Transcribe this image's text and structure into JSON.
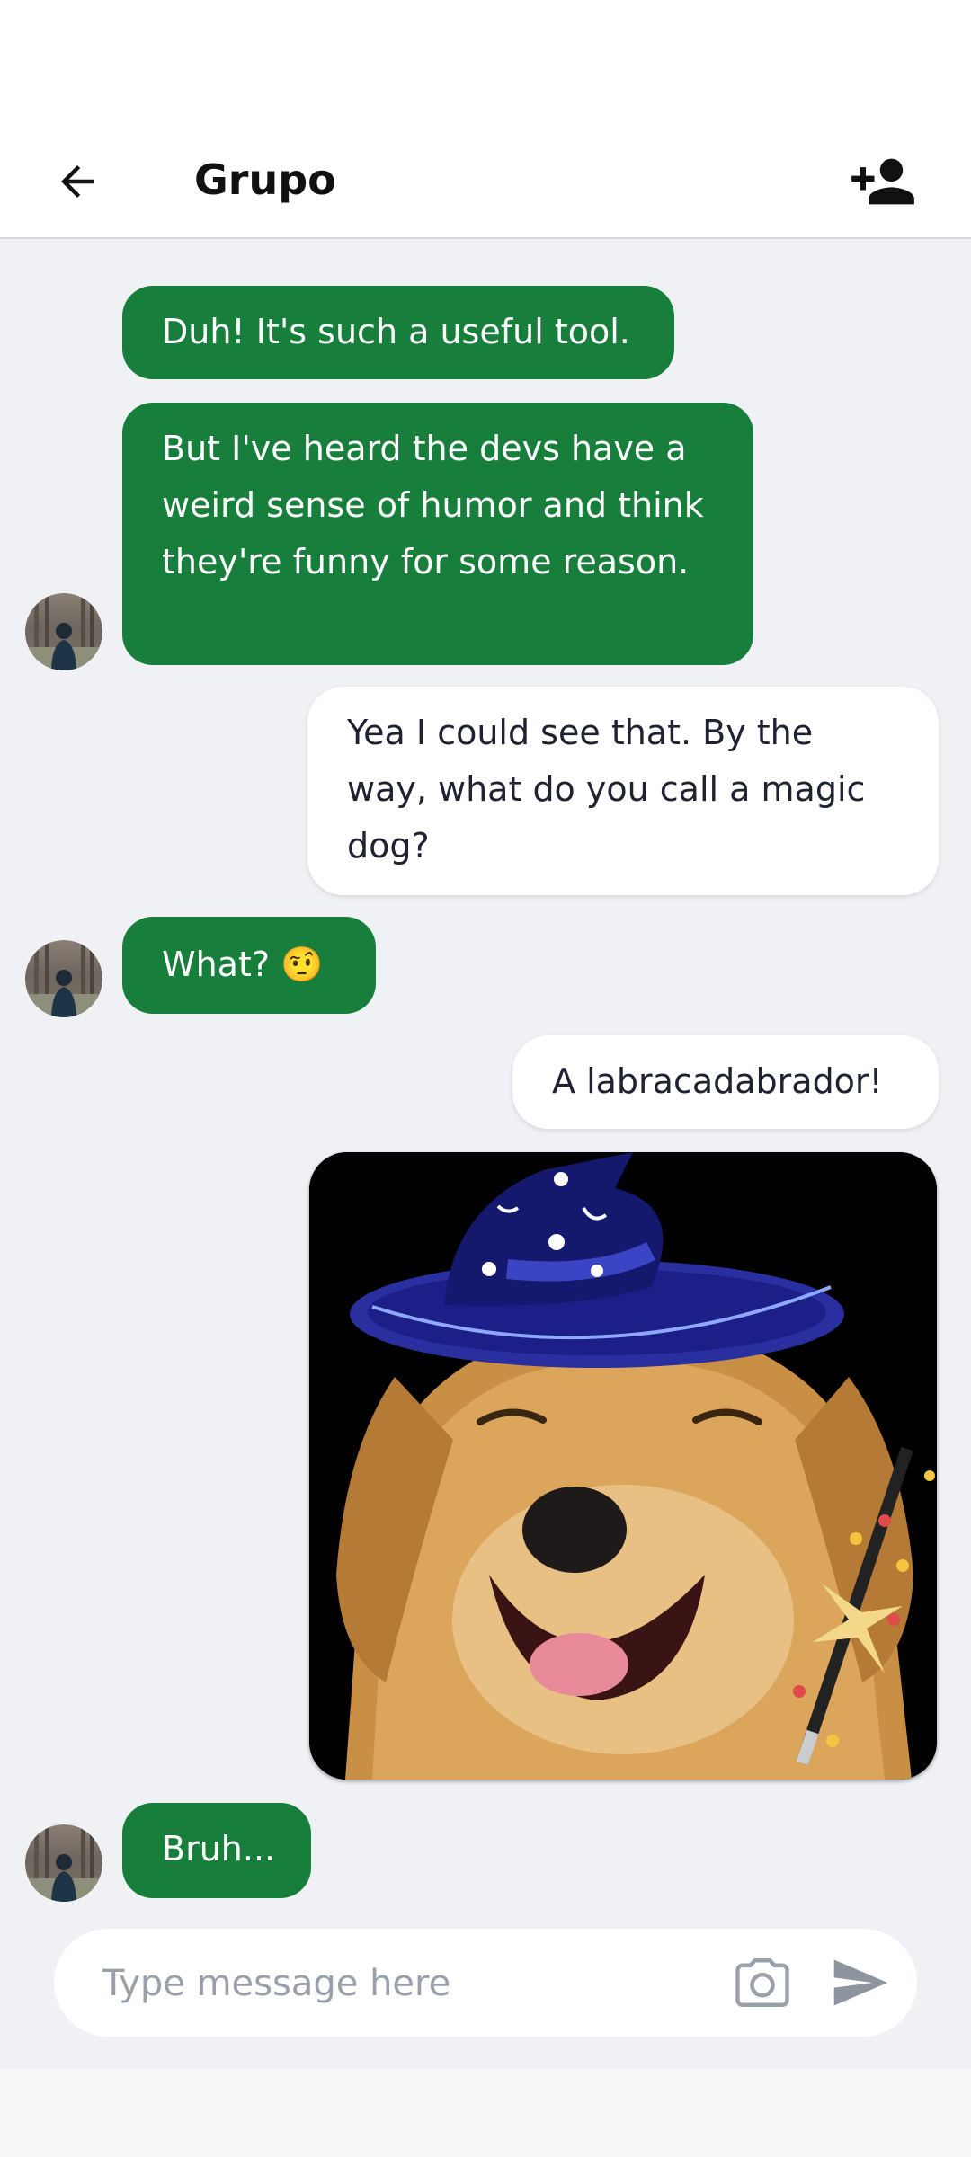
{
  "header": {
    "back_icon": "arrow-left-icon",
    "title": "Grupo",
    "add_member_icon": "person-add-icon"
  },
  "messages": [
    {
      "direction": "incoming",
      "text": "Duh! It's such a useful tool."
    },
    {
      "direction": "incoming",
      "text": "But I've heard the devs have a weird sense of humor and think they're funny for some reason."
    },
    {
      "direction": "outgoing",
      "text": "Yea I could see that. By the way, what do you call a magic dog?"
    },
    {
      "direction": "incoming",
      "text": "What? 🤨"
    },
    {
      "direction": "outgoing",
      "text": "A labracadabrador!"
    },
    {
      "direction": "outgoing",
      "type": "image",
      "image_subject": "golden retriever wearing a blue wizard hat with a magic wand"
    },
    {
      "direction": "incoming",
      "text": "Bruh..."
    }
  ],
  "composer": {
    "placeholder": "Type message here",
    "camera_icon": "camera-icon",
    "send_icon": "send-icon"
  },
  "colors": {
    "incoming_bubble": "#177f3b",
    "outgoing_bubble": "#ffffff",
    "background": "#f0f1f5"
  }
}
